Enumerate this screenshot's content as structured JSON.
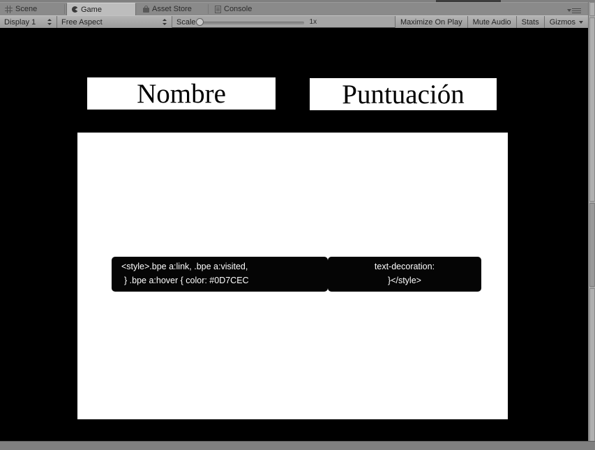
{
  "window": {
    "tabs": [
      {
        "label": "Scene",
        "icon": "grid-icon",
        "active": false
      },
      {
        "label": "Game",
        "icon": "pacman-icon",
        "active": true
      },
      {
        "label": "Asset Store",
        "icon": "shopping-bag-icon",
        "active": false
      },
      {
        "label": "Console",
        "icon": "document-icon",
        "active": false
      }
    ],
    "menu_icon": "hamburger-menu-icon"
  },
  "toolbar": {
    "display_dropdown": "Display 1",
    "aspect_dropdown": "Free Aspect",
    "scale_label": "Scale",
    "scale_value": "1x",
    "maximize_on_play": "Maximize On Play",
    "mute_audio": "Mute Audio",
    "stats": "Stats",
    "gizmos": "Gizmos"
  },
  "game": {
    "background_color": "#000000",
    "panel_color": "#ffffff",
    "labels": {
      "name_header": "Nombre",
      "score_header": "Puntuación"
    },
    "code_overlay": {
      "left": [
        "<style>.bpe a:link, .bpe a:visited,",
        "} .bpe a:hover { color: #0D7CEC"
      ],
      "right": [
        "text-decoration:",
        "}</style>"
      ],
      "accent_color": "#0D7CEC"
    }
  }
}
